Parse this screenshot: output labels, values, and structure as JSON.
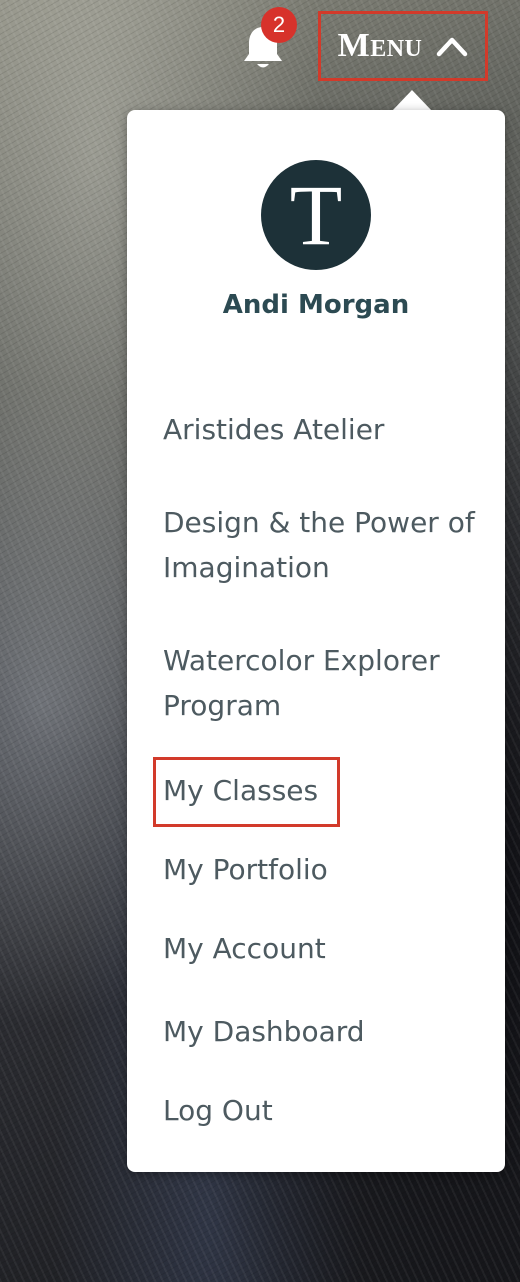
{
  "header": {
    "notification_count": "2",
    "menu_label": "Menu",
    "menu_expanded": true,
    "highlight_color": "#d23a2a",
    "badge_color": "#d7322b",
    "icons": {
      "notifications": "bell-icon",
      "menu_toggle": "chevron-up-icon"
    }
  },
  "dropdown": {
    "avatar_letter": "T",
    "avatar_color": "#1d3138",
    "user_name": "Andi Morgan",
    "items": [
      {
        "label": "Aristides Atelier"
      },
      {
        "label": "Design & the Power of Imagination"
      },
      {
        "label": "Watercolor Explorer Program"
      },
      {
        "label": "My Classes",
        "highlighted": true
      },
      {
        "label": "My Portfolio"
      },
      {
        "label": "My Account"
      },
      {
        "label": "My Dashboard"
      },
      {
        "label": "Log Out"
      }
    ]
  }
}
